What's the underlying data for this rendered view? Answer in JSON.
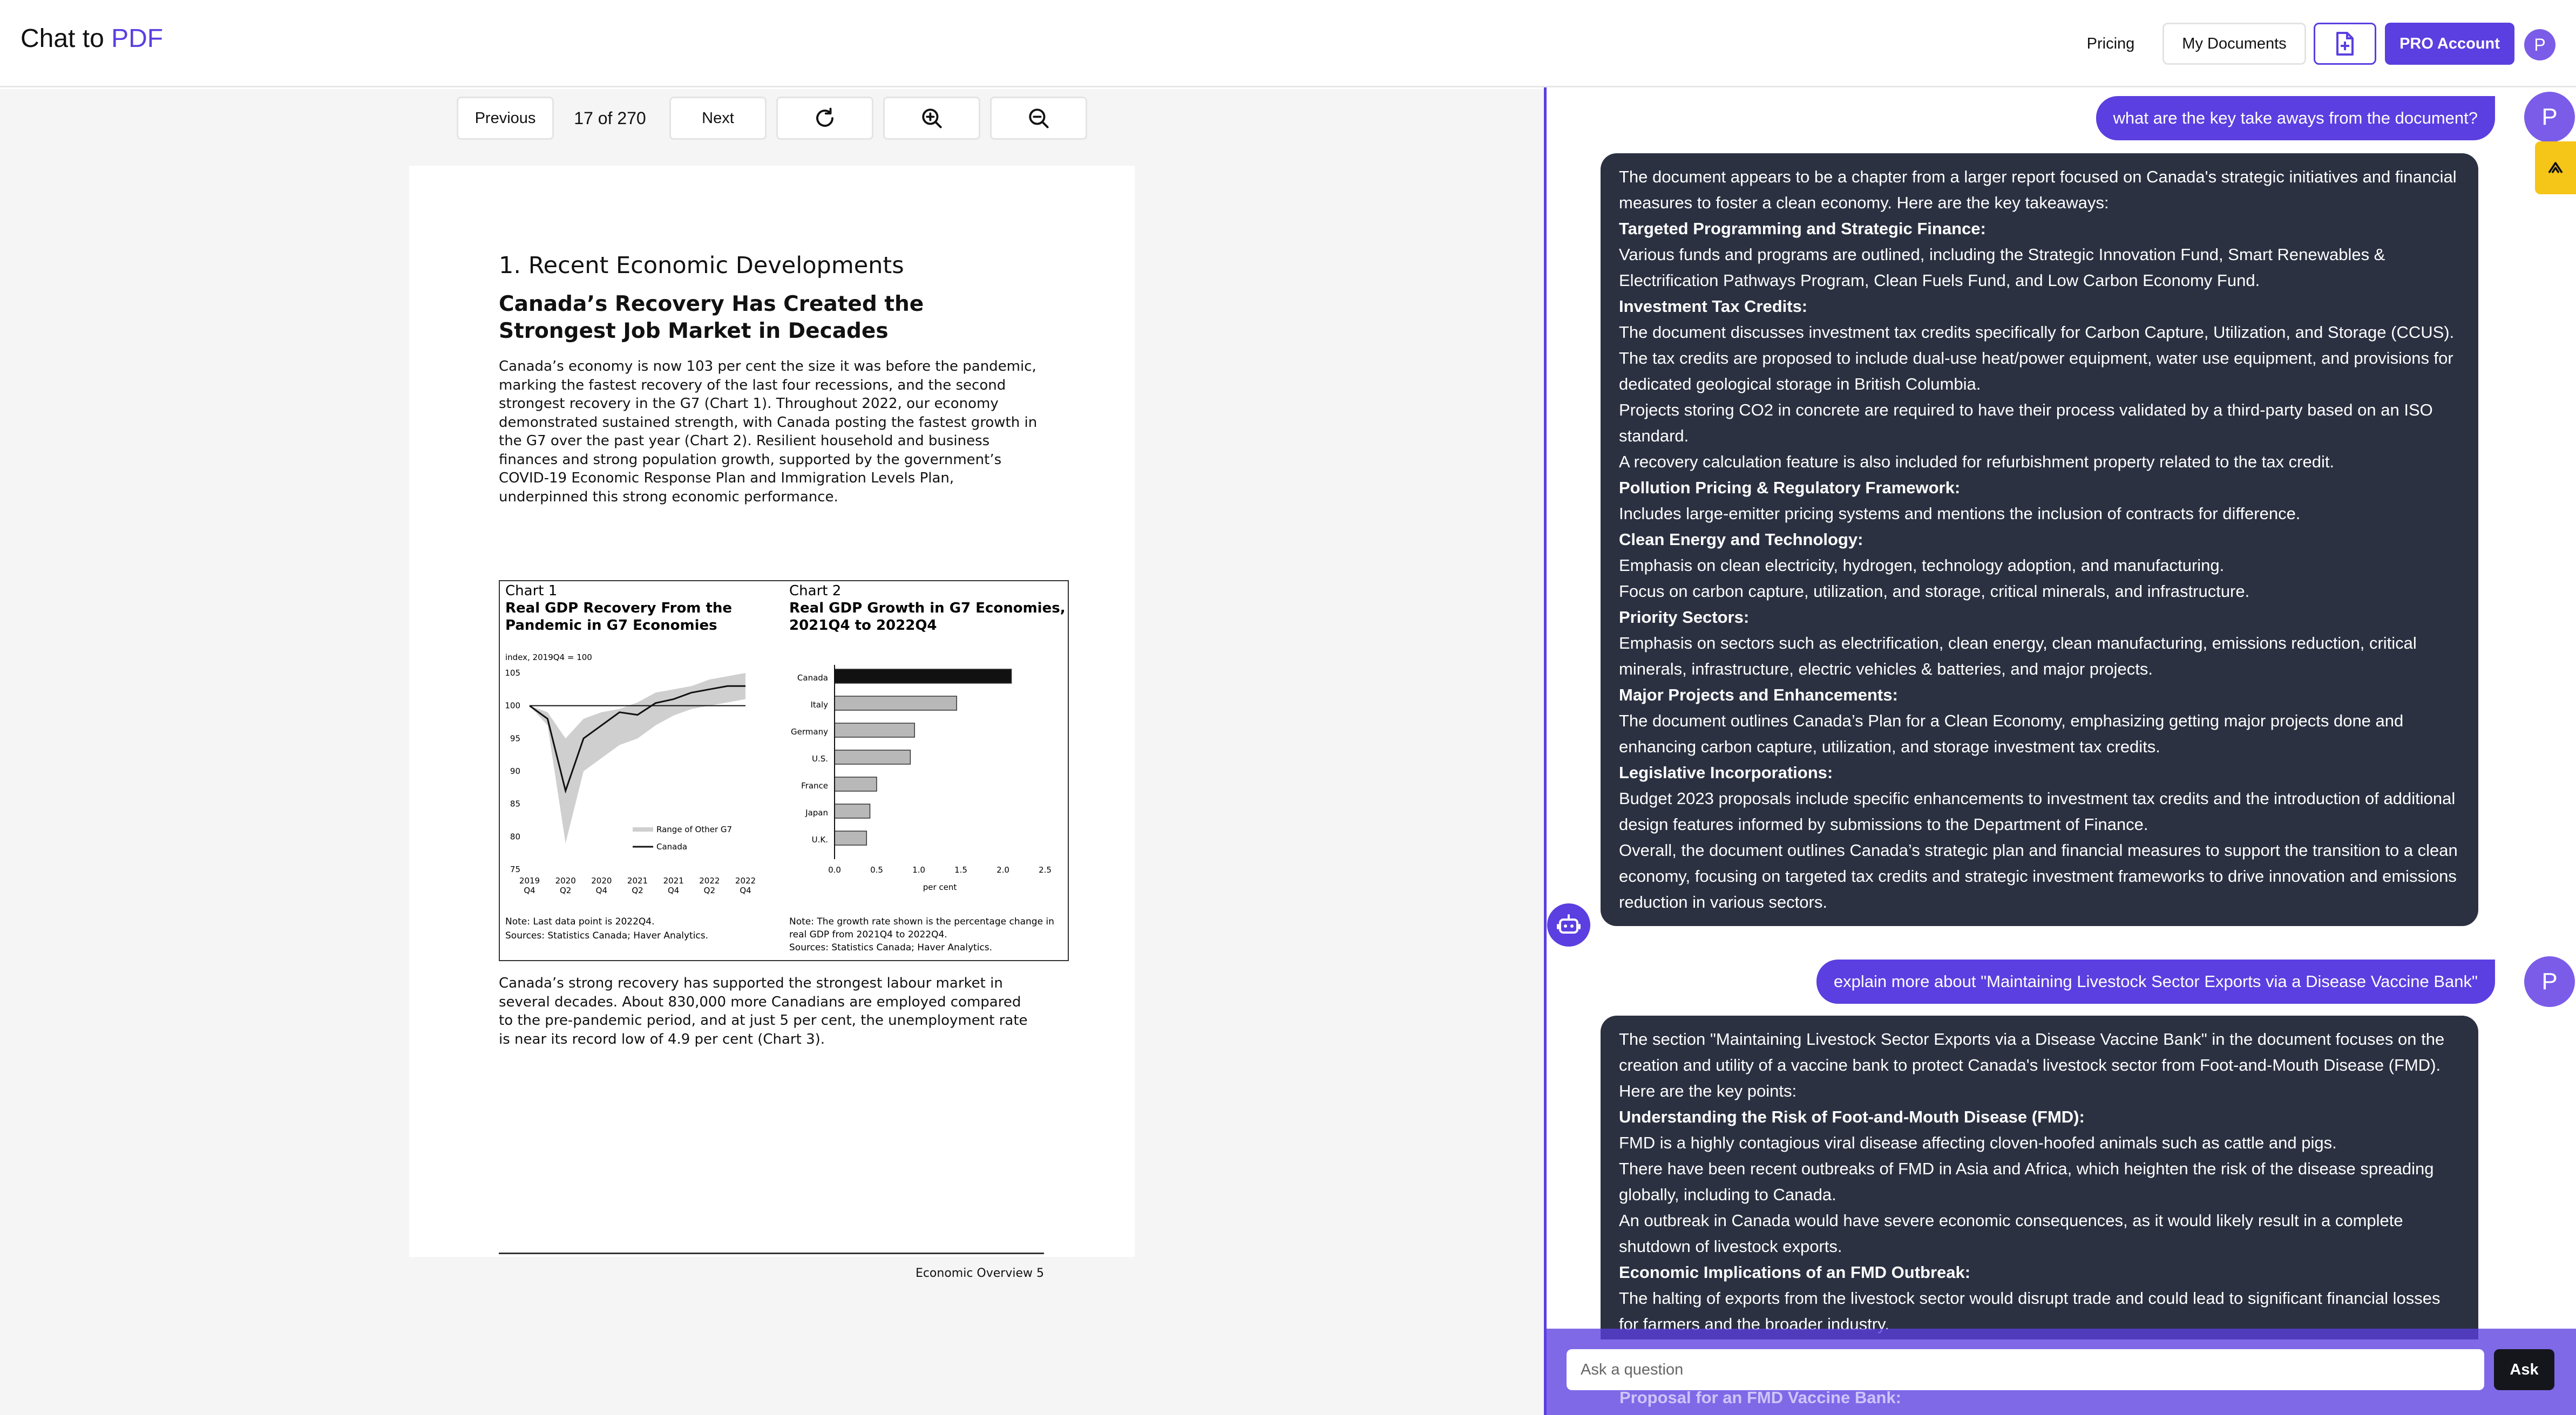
{
  "header": {
    "brand_prefix": "Chat to ",
    "brand_accent": "PDF",
    "pricing": "Pricing",
    "my_documents": "My Documents",
    "pro_account": "PRO Account",
    "avatar": "P"
  },
  "viewer": {
    "previous": "Previous",
    "page_indicator": "17 of 270",
    "next": "Next"
  },
  "pdf": {
    "section": "1. Recent Economic Developments",
    "heading": "Canada’s Recovery Has Created the Strongest Job Market in Decades",
    "para1": "Canada’s economy is now 103 per cent the size it was before the pandemic, marking the fastest recovery of the last four recessions, and the second strongest recovery in the G7 (Chart 1). Throughout 2022, our economy demonstrated sustained strength, with Canada posting the fastest growth in the G7 over the past year (Chart 2). Resilient household and business finances and strong population growth, supported by the government’s COVID-19 Economic Response Plan and Immigration Levels Plan, underpinned this strong economic performance.",
    "para2": "Canada’s strong recovery has supported the strongest labour market in several decades. About 830,000 more Canadians are employed compared to the pre-pandemic period, and at just 5 per cent, the unemployment rate is near its record low of 4.9 per cent (Chart 3).",
    "footer": "Economic Overview  5"
  },
  "chart_data": [
    {
      "type": "line",
      "label": "Chart 1",
      "title": "Real GDP Recovery From the Pandemic in G7 Economies",
      "ylabel": "index, 2019Q4 = 100",
      "ylim": [
        75,
        105
      ],
      "yticks": [
        75,
        80,
        85,
        90,
        95,
        100,
        105
      ],
      "xticks": [
        "2019\nQ4",
        "2020\nQ2",
        "2020\nQ4",
        "2021\nQ2",
        "2021\nQ4",
        "2022\nQ2",
        "2022\nQ4"
      ],
      "x": [
        0,
        1,
        2,
        3,
        4,
        5,
        6,
        7,
        8,
        9,
        10,
        11,
        12
      ],
      "series": [
        {
          "name": "Canada",
          "values": [
            100,
            98,
            87,
            95,
            97,
            99,
            98.6,
            100.4,
            101,
            102,
            102.5,
            103,
            103
          ]
        },
        {
          "name": "Range of Other G7",
          "type": "band",
          "low": [
            100,
            97,
            79,
            90,
            92,
            94,
            95,
            97,
            98.5,
            99.5,
            100,
            100.5,
            101
          ],
          "high": [
            100,
            99,
            95,
            98,
            99,
            99.5,
            100.5,
            102,
            102.5,
            103,
            104,
            104.5,
            105
          ]
        }
      ],
      "note": "Note: Last data point is 2022Q4.",
      "sources": "Sources: Statistics Canada; Haver Analytics."
    },
    {
      "type": "bar",
      "orientation": "horizontal",
      "label": "Chart 2",
      "title": "Real GDP Growth in G7 Economies, 2021Q4 to 2022Q4",
      "categories": [
        "Canada",
        "Italy",
        "Germany",
        "U.S.",
        "France",
        "Japan",
        "U.K."
      ],
      "values": [
        2.1,
        1.45,
        0.95,
        0.9,
        0.5,
        0.42,
        0.38
      ],
      "xlim": [
        0,
        2.5
      ],
      "xticks": [
        "0.0",
        "0.5",
        "1.0",
        "1.5",
        "2.0",
        "2.5"
      ],
      "xlabel": "per cent",
      "note": "Note: The growth rate shown is the percentage change in real GDP from 2021Q4 to 2022Q4.",
      "sources": "Sources: Statistics Canada; Haver Analytics."
    }
  ],
  "chat": {
    "user_avatar": "P",
    "q1": "what are the key take aways from the document?",
    "a1": [
      {
        "t": "The document appears to be a chapter from a larger report focused on Canada's strategic initiatives and financial measures to foster a clean economy. Here are the key takeaways:"
      },
      {
        "t": "Targeted Programming and Strategic Finance:",
        "b": true
      },
      {
        "t": "Various funds and programs are outlined, including the Strategic Innovation Fund, Smart Renewables & Electrification Pathways Program, Clean Fuels Fund, and Low Carbon Economy Fund."
      },
      {
        "t": "Investment Tax Credits:",
        "b": true
      },
      {
        "t": "The document discusses investment tax credits specifically for Carbon Capture, Utilization, and Storage (CCUS)."
      },
      {
        "t": "The tax credits are proposed to include dual-use heat/power equipment, water use equipment, and provisions for dedicated geological storage in British Columbia."
      },
      {
        "t": "Projects storing CO2 in concrete are required to have their process validated by a third-party based on an ISO standard."
      },
      {
        "t": "A recovery calculation feature is also included for refurbishment property related to the tax credit."
      },
      {
        "t": "Pollution Pricing & Regulatory Framework:",
        "b": true
      },
      {
        "t": "Includes large-emitter pricing systems and mentions the inclusion of contracts for difference."
      },
      {
        "t": "Clean Energy and Technology:",
        "b": true
      },
      {
        "t": "Emphasis on clean electricity, hydrogen, technology adoption, and manufacturing."
      },
      {
        "t": "Focus on carbon capture, utilization, and storage, critical minerals, and infrastructure."
      },
      {
        "t": "Priority Sectors:",
        "b": true
      },
      {
        "t": "Emphasis on sectors such as electrification, clean energy, clean manufacturing, emissions reduction, critical minerals, infrastructure, electric vehicles & batteries, and major projects."
      },
      {
        "t": "Major Projects and Enhancements:",
        "b": true
      },
      {
        "t": "The document outlines Canada’s Plan for a Clean Economy, emphasizing getting major projects done and enhancing carbon capture, utilization, and storage investment tax credits."
      },
      {
        "t": "Legislative Incorporations:",
        "b": true
      },
      {
        "t": "Budget 2023 proposals include specific enhancements to investment tax credits and the introduction of additional design features informed by submissions to the Department of Finance."
      },
      {
        "t": "Overall, the document outlines Canada’s strategic plan and financial measures to support the transition to a clean economy, focusing on targeted tax credits and strategic investment frameworks to drive innovation and emissions reduction in various sectors."
      }
    ],
    "q2": "explain more about \"Maintaining Livestock Sector Exports via a Disease Vaccine Bank\"",
    "a2": [
      {
        "t": "The section \"Maintaining Livestock Sector Exports via a Disease Vaccine Bank\" in the document focuses on the creation and utility of a vaccine bank to protect Canada's livestock sector from Foot-and-Mouth Disease (FMD)."
      },
      {
        "t": "Here are the key points:"
      },
      {
        "t": "Understanding the Risk of Foot-and-Mouth Disease (FMD):",
        "b": true
      },
      {
        "t": "FMD is a highly contagious viral disease affecting cloven-hoofed animals such as cattle and pigs."
      },
      {
        "t": "There have been recent outbreaks of FMD in Asia and Africa, which heighten the risk of the disease spreading globally, including to Canada."
      },
      {
        "t": "An outbreak in Canada would have severe economic consequences, as it would likely result in a complete shutdown of livestock exports."
      },
      {
        "t": "Economic Implications of an FMD Outbreak:",
        "b": true
      },
      {
        "t": "The halting of exports from the livestock sector would disrupt trade and could lead to significant financial losses for farmers and the broader industry."
      }
    ],
    "obscured_heading": "Proposal for an FMD Vaccine Bank:",
    "input_placeholder": "Ask a question",
    "ask": "Ask"
  },
  "colors": {
    "accent": "#5b3fe0",
    "bot_bubble": "#2b3141",
    "side_tab": "#f5c518"
  }
}
